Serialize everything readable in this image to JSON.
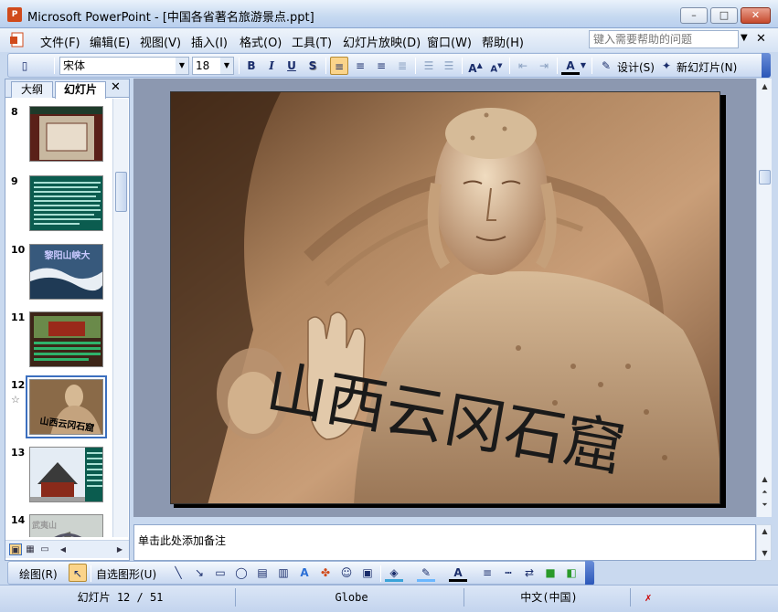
{
  "window": {
    "title": "Microsoft PowerPoint - [中国各省著名旅游景点.ppt]",
    "app_icon_label": "P",
    "min_label": "–",
    "max_label": "□",
    "close_label": "✕"
  },
  "menu": {
    "items": [
      "文件(F)",
      "编辑(E)",
      "视图(V)",
      "插入(I)",
      "格式(O)",
      "工具(T)",
      "幻灯片放映(D)",
      "窗口(W)",
      "帮助(H)"
    ],
    "help_placeholder": "键入需要帮助的问题",
    "doc_close": "✕"
  },
  "format_toolbar": {
    "font_name": "宋体",
    "font_size": "18",
    "bold": "B",
    "italic": "I",
    "underline": "U",
    "shadow": "S",
    "design_label": "设计(S)",
    "new_slide_label": "新幻灯片(N)",
    "active_alignment": "left"
  },
  "left_panel": {
    "tabs": [
      "大纲",
      "幻灯片"
    ],
    "active_tab": "幻灯片",
    "close": "✕",
    "slides": [
      {
        "number": "8",
        "caption": ""
      },
      {
        "number": "9",
        "caption": ""
      },
      {
        "number": "10",
        "caption": "黎阳山峡大"
      },
      {
        "number": "11",
        "caption": ""
      },
      {
        "number": "12",
        "caption": "山西云冈石窟",
        "selected": true,
        "has_animation": true
      },
      {
        "number": "13",
        "caption": ""
      },
      {
        "number": "14",
        "caption": "武夷山"
      }
    ]
  },
  "slide": {
    "title": "山西云冈石窟"
  },
  "notes": {
    "placeholder": "单击此处添加备注"
  },
  "draw_toolbar": {
    "draw_label": "绘图(R)",
    "autoshapes_label": "自选图形(U)"
  },
  "status": {
    "slide_position": "幻灯片 12 / 51",
    "template": "Globe",
    "language": "中文(中国)"
  },
  "colors": {
    "accent": "#3b6fbf",
    "slide_bg": "#8c98b0"
  }
}
